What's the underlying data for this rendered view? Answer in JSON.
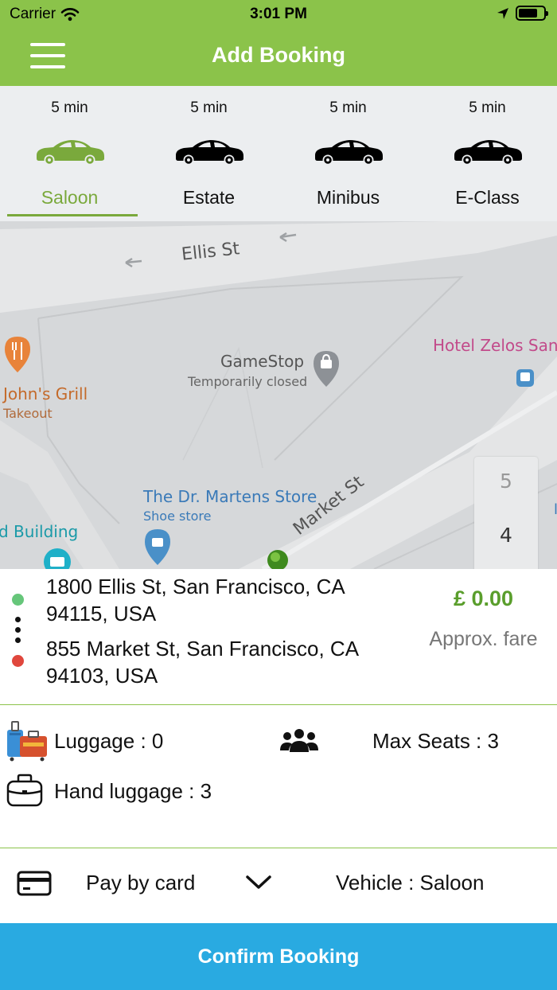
{
  "status_bar": {
    "carrier": "Carrier",
    "time": "3:01 PM"
  },
  "header": {
    "title": "Add Booking"
  },
  "vehicle_tabs": [
    {
      "eta": "5 min",
      "label": "Saloon",
      "active": true
    },
    {
      "eta": "5 min",
      "label": "Estate",
      "active": false
    },
    {
      "eta": "5 min",
      "label": "Minibus",
      "active": false
    },
    {
      "eta": "5 min",
      "label": "E-Class",
      "active": false
    }
  ],
  "map": {
    "streets": {
      "ellis": "Ellis St",
      "market": "Market St"
    },
    "places": {
      "gamestop": {
        "name": "GameStop",
        "note": "Temporarily closed"
      },
      "hotel": "Hotel Zelos San",
      "johns_grill": {
        "name": "John's Grill",
        "note": "Takeout"
      },
      "dr_martens": {
        "name": "The Dr. Martens Store",
        "note": "Shoe store"
      },
      "building": "d Building",
      "edge": "l"
    },
    "zoom_levels": [
      "5",
      "4"
    ]
  },
  "route": {
    "pickup": "1800 Ellis St, San Francisco, CA 94115, USA",
    "dropoff": "855 Market St, San Francisco, CA 94103, USA",
    "fare": "£ 0.00",
    "fare_label": "Approx. fare"
  },
  "info": {
    "luggage": "Luggage : 0",
    "max_seats": "Max Seats : 3",
    "hand_luggage": "Hand luggage : 3"
  },
  "payment": {
    "method": "Pay by card",
    "vehicle": "Vehicle : Saloon"
  },
  "confirm_label": "Confirm Booking",
  "colors": {
    "header": "#8bc34a",
    "active_tab": "#7aa93c",
    "fare": "#5a9e2c",
    "pickup_dot": "#66c67a",
    "dropoff_dot": "#e0473d",
    "confirm": "#29aae1"
  }
}
